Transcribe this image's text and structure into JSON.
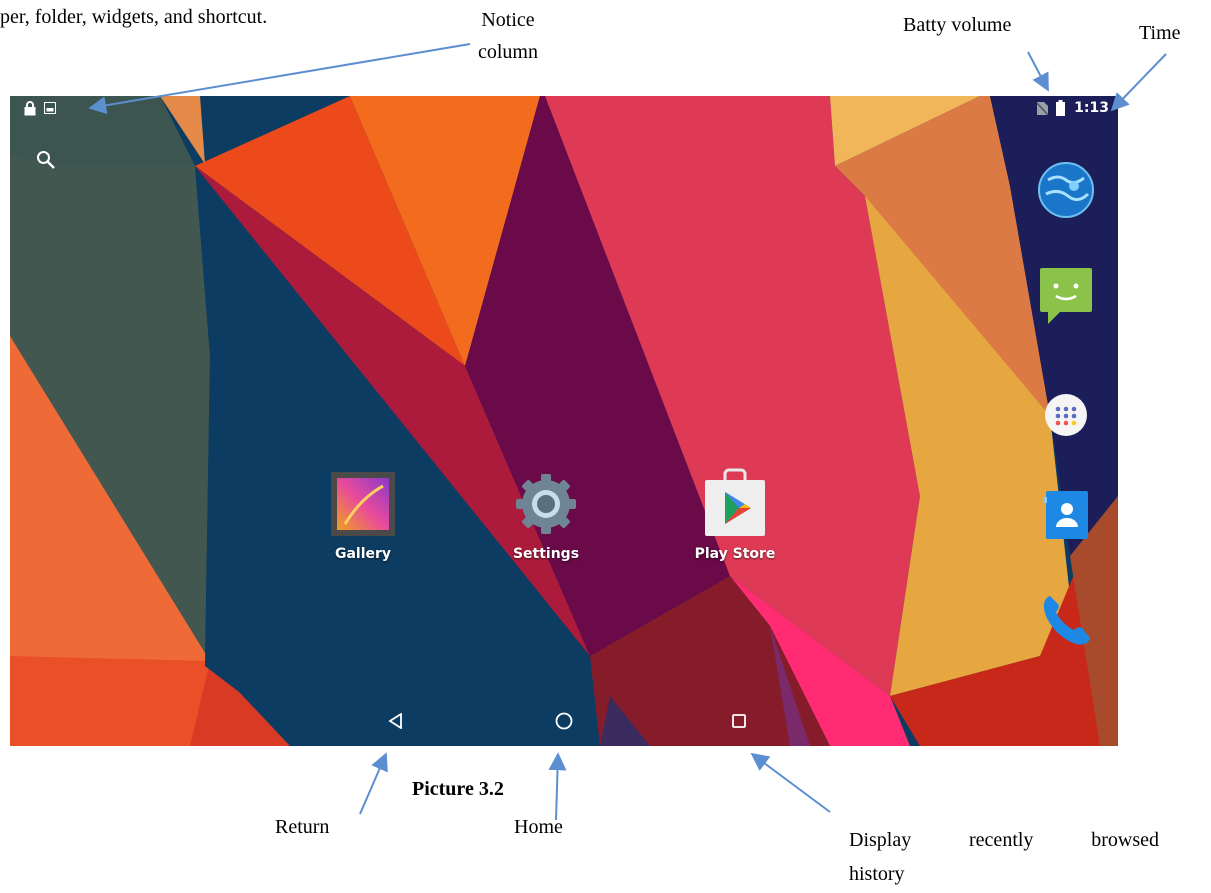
{
  "document": {
    "intro_text": "per, folder, widgets, and shortcut.",
    "caption": "Picture 3.2"
  },
  "callouts": {
    "notice_line1": "Notice",
    "notice_line2": "column",
    "battery": "Batty volume",
    "time": "Time",
    "return": "Return",
    "home": "Home",
    "recent_line1": "Display recently browsed",
    "recent_line2": "history"
  },
  "status_bar": {
    "time": "1:13",
    "left_icons": [
      "lock-icon",
      "image-notification-icon"
    ],
    "right_icons": [
      "no-sim-icon",
      "battery-icon"
    ]
  },
  "home_screen": {
    "apps": [
      {
        "label": "Gallery",
        "icon": "gallery-icon"
      },
      {
        "label": "Settings",
        "icon": "settings-icon"
      },
      {
        "label": "Play Store",
        "icon": "play-store-icon"
      }
    ],
    "dock": [
      "browser-globe-icon",
      "messaging-icon",
      "app-drawer-icon",
      "contacts-icon",
      "phone-icon"
    ],
    "nav": [
      "back-icon",
      "home-icon",
      "recents-icon"
    ]
  },
  "colors": {
    "annotation_arrow": "#5b8fd0"
  }
}
